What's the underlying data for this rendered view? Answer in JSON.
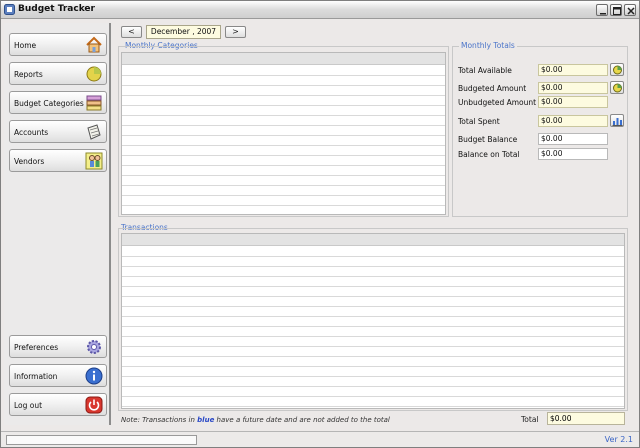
{
  "window": {
    "title": "Budget Tracker",
    "controls": [
      "minimize",
      "maximize",
      "close"
    ]
  },
  "sidebar": {
    "top_items": [
      {
        "label": "Home",
        "icon": "house-icon"
      },
      {
        "label": "Reports",
        "icon": "pie-chart-icon"
      },
      {
        "label": "Budget Categories",
        "icon": "categories-icon"
      },
      {
        "label": "Accounts",
        "icon": "ledger-icon"
      },
      {
        "label": "Vendors",
        "icon": "vendors-icon"
      }
    ],
    "bottom_items": [
      {
        "label": "Preferences",
        "icon": "gear-icon"
      },
      {
        "label": "Information",
        "icon": "info-icon"
      },
      {
        "label": "Log out",
        "icon": "power-icon"
      }
    ]
  },
  "date_nav": {
    "prev_label": "<",
    "next_label": ">",
    "current": "December , 2007"
  },
  "monthly_categories": {
    "label": "Monthly Categories",
    "rows": []
  },
  "monthly_totals": {
    "label": "Monthly Totals",
    "total_available": {
      "label": "Total Available",
      "value": "$0.00"
    },
    "budgeted_amount": {
      "label": "Budgeted Amount",
      "value": "$0.00"
    },
    "unbudgeted_amount": {
      "label": "Unbudgeted Amount",
      "value": "$0.00"
    },
    "total_spent": {
      "label": "Total Spent",
      "value": "$0.00"
    },
    "budget_balance": {
      "label": "Budget Balance",
      "value": "$0.00"
    },
    "balance_on_total": {
      "label": "Balance on Total",
      "value": "$0.00"
    }
  },
  "transactions": {
    "label": "Transactions",
    "rows": [],
    "note_prefix": "Note: Transactions in ",
    "note_blue": "blue",
    "note_suffix": " have a future date and are not added to the total",
    "total_label": "Total",
    "total_value": "$0.00"
  },
  "status": {
    "version": "Ver 2.1"
  },
  "colors": {
    "accent_text": "#4a74c9",
    "field_bg": "#fdfbe0",
    "window_bg": "#ece9e8"
  }
}
